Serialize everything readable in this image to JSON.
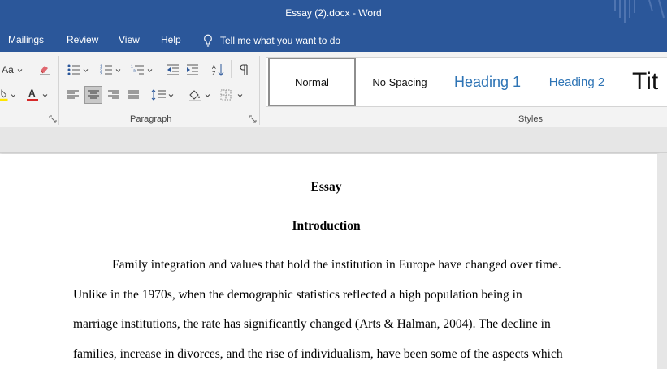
{
  "window": {
    "title": "Essay (2).docx  -  Word"
  },
  "ribbon_tabs": [
    {
      "label": "Mailings"
    },
    {
      "label": "Review"
    },
    {
      "label": "View"
    },
    {
      "label": "Help"
    }
  ],
  "tell_me": {
    "label": "Tell me what you want to do",
    "icon": "lightbulb-icon"
  },
  "font_group": {
    "change_case_label": "Aa",
    "highlight_color": "#ffe600",
    "font_color": "#d62929"
  },
  "paragraph_group": {
    "label": "Paragraph"
  },
  "styles_group": {
    "label": "Styles",
    "items": [
      {
        "label": "Normal",
        "selected": true
      },
      {
        "label": "No Spacing"
      },
      {
        "label": "Heading 1"
      },
      {
        "label": "Heading 2"
      },
      {
        "label": "Tit"
      }
    ]
  },
  "document": {
    "heading": "Essay",
    "subheading": "Introduction",
    "lines": [
      "Family integration and values that hold the institution in Europe have changed over time.",
      "Unlike in the 1970s, when the demographic statistics reflected a high population being in",
      "marriage institutions, the rate has significantly changed (Arts & Halman, 2004). The decline in",
      "families, increase in divorces, and the rise of individualism, have been some of the aspects which"
    ]
  },
  "colors": {
    "title_bar": "#2b579a",
    "ribbon_bg": "#f3f3f3",
    "heading_text": "#2e74b5",
    "canvas": "#e6e6e6"
  }
}
